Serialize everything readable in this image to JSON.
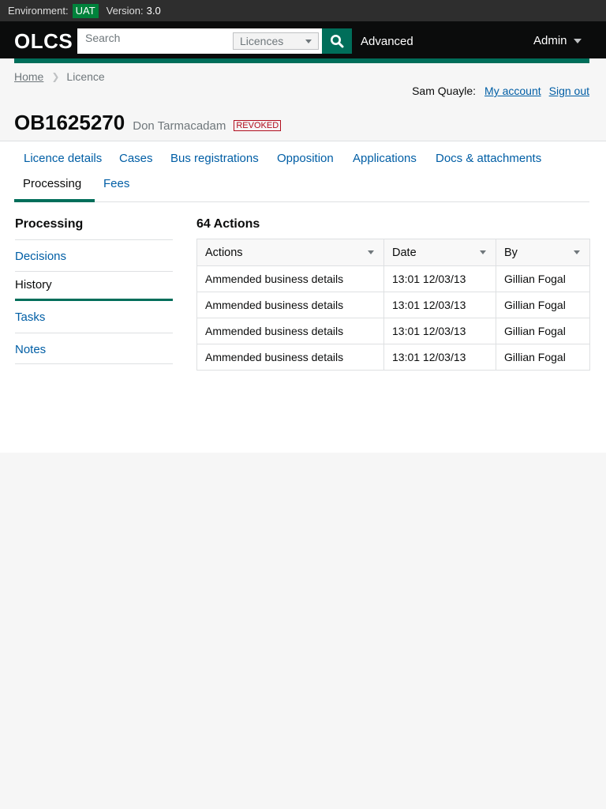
{
  "environment": {
    "label": "Environment:",
    "value": "UAT",
    "version_label": "Version:",
    "version": "3.0"
  },
  "header": {
    "logo": "OLCS",
    "search_placeholder": "Search",
    "search_scope": "Licences",
    "advanced_label": "Advanced",
    "admin_label": "Admin"
  },
  "breadcrumb": {
    "home": "Home",
    "current": "Licence"
  },
  "user": {
    "name": "Sam Quayle:",
    "my_account": "My account",
    "sign_out": "Sign out"
  },
  "page": {
    "licence_number": "OB1625270",
    "operator": "Don Tarmacadam",
    "status": "REVOKED"
  },
  "tabs": [
    "Licence details",
    "Cases",
    "Bus registrations",
    "Opposition",
    "Applications",
    "Docs & attachments",
    "Processing",
    "Fees"
  ],
  "sidebar": {
    "title": "Processing",
    "items": [
      "Decisions",
      "History",
      "Tasks",
      "Notes"
    ]
  },
  "table": {
    "title": "64 Actions",
    "headers": [
      "Actions",
      "Date",
      "By"
    ],
    "rows": [
      [
        "Ammended business details",
        "13:01 12/03/13",
        "Gillian Fogal"
      ],
      [
        "Ammended business details",
        "13:01 12/03/13",
        "Gillian Fogal"
      ],
      [
        "Ammended business details",
        "13:01 12/03/13",
        "Gillian Fogal"
      ],
      [
        "Ammended business details",
        "13:01 12/03/13",
        "Gillian Fogal"
      ]
    ]
  },
  "colors": {
    "brand_green": "#006e5a",
    "env_green": "#00823b",
    "link": "#005ea5",
    "revoked": "#b10e1e"
  }
}
